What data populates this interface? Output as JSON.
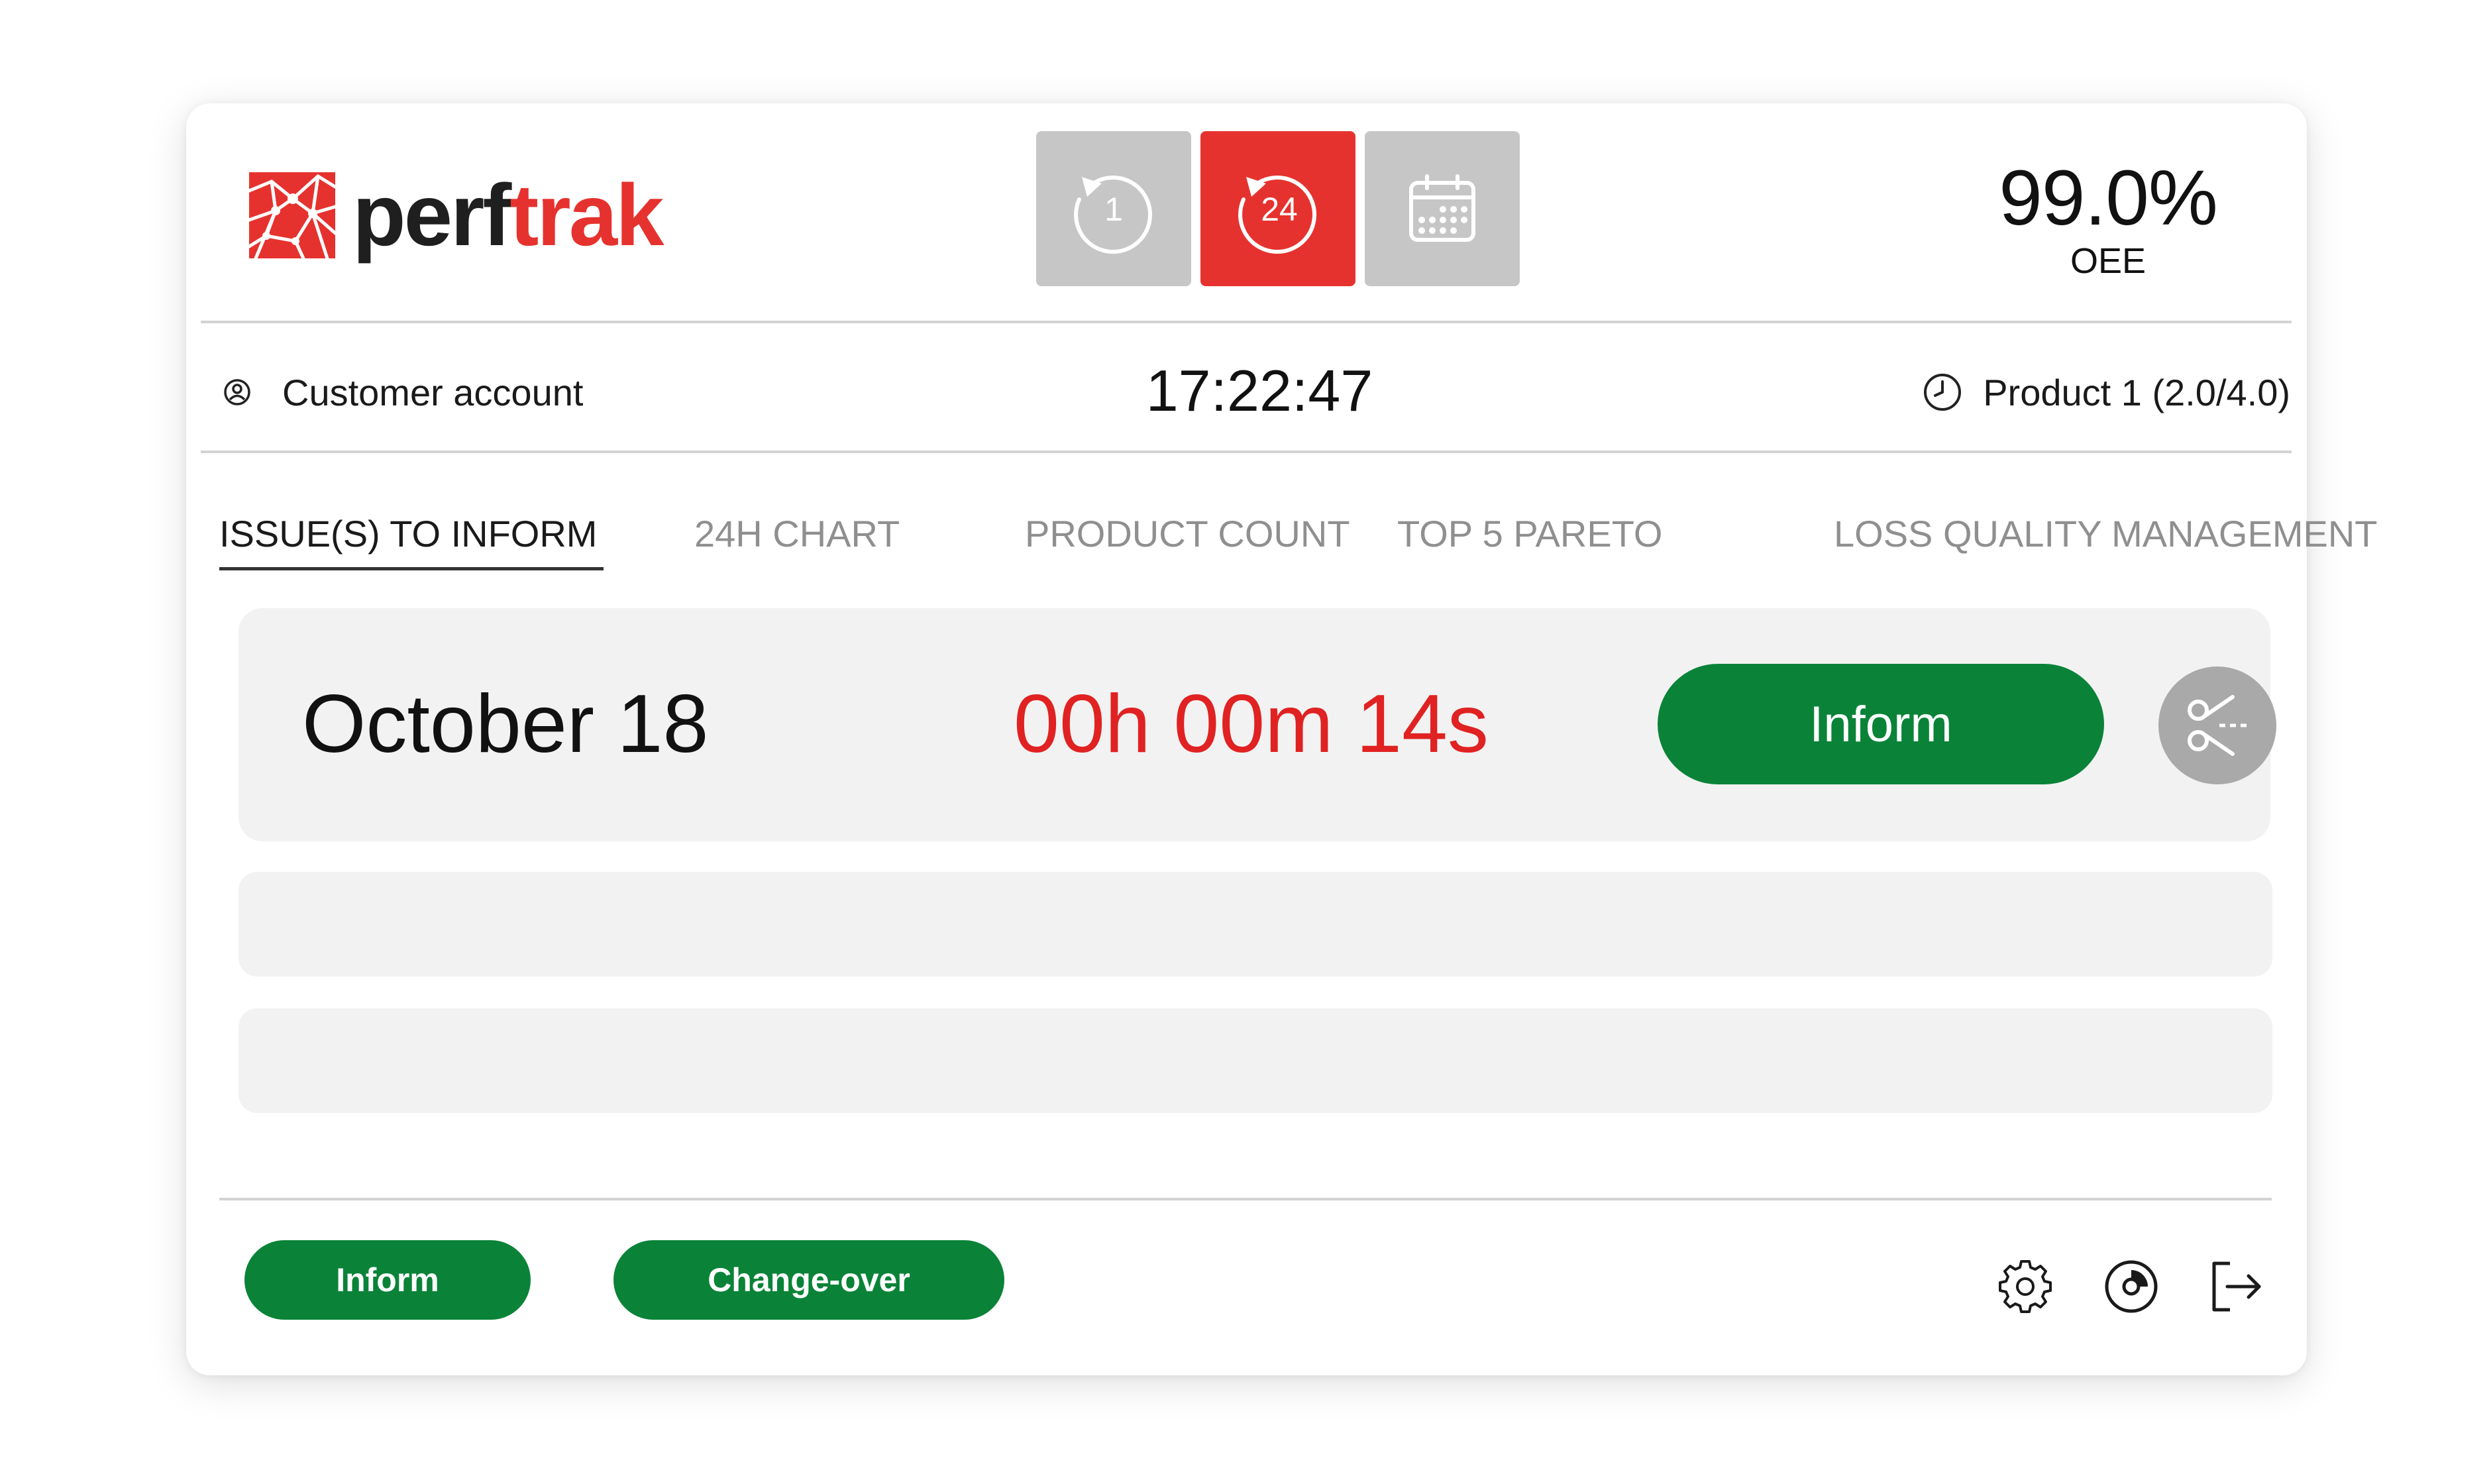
{
  "brand": {
    "logo_icon": "perftrak-network-logo",
    "name_part1": "perf",
    "name_part2": "trak",
    "accent_color": "#e6322e",
    "dark_color": "#1f1f1f"
  },
  "header": {
    "modes": [
      {
        "id": "last-hour",
        "icon": "history-1-icon",
        "label": "1",
        "active": false
      },
      {
        "id": "last-24h",
        "icon": "history-24-icon",
        "label": "24",
        "active": true
      },
      {
        "id": "calendar",
        "icon": "calendar-icon",
        "label": "",
        "active": false
      }
    ],
    "oee_value": "99.0%",
    "oee_label": "OEE"
  },
  "info": {
    "account_icon": "user-circle-icon",
    "account": "Customer account",
    "time": "17:22:47",
    "product_icon": "clock-icon",
    "product": "Product 1 (2.0/4.0)"
  },
  "tabs": [
    {
      "label": "ISSUE(S) TO INFORM",
      "active": true
    },
    {
      "label": "24H CHART",
      "active": false
    },
    {
      "label": "PRODUCT COUNT",
      "active": false
    },
    {
      "label": "TOP 5 PARETO",
      "active": false
    },
    {
      "label": "LOSS QUALITY MANAGEMENT",
      "active": false
    }
  ],
  "issues": [
    {
      "date": "October 18",
      "duration": "00h 00m 14s",
      "action_label": "Inform",
      "secondary_icon": "scissors-icon"
    }
  ],
  "footer": {
    "inform_label": "Inform",
    "changeover_label": "Change-over",
    "icons": [
      "gear-icon",
      "disc-icon",
      "logout-icon"
    ]
  },
  "colors": {
    "primary_green": "#0a8338",
    "alert_red": "#e02222",
    "inactive_gray": "#c6c6c6",
    "row_background": "#f2f2f2"
  }
}
